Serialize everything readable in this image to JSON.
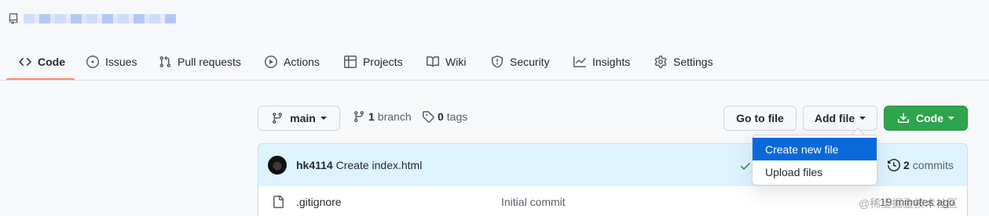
{
  "repo": {
    "name_blurred": ""
  },
  "nav": {
    "tabs": [
      {
        "label": "Code",
        "icon": "code-icon",
        "selected": true
      },
      {
        "label": "Issues",
        "icon": "issue-icon"
      },
      {
        "label": "Pull requests",
        "icon": "pull-request-icon"
      },
      {
        "label": "Actions",
        "icon": "play-icon"
      },
      {
        "label": "Projects",
        "icon": "table-icon"
      },
      {
        "label": "Wiki",
        "icon": "book-icon"
      },
      {
        "label": "Security",
        "icon": "shield-icon"
      },
      {
        "label": "Insights",
        "icon": "graph-icon"
      },
      {
        "label": "Settings",
        "icon": "gear-icon"
      }
    ]
  },
  "toolbar": {
    "branch_label": "main",
    "branch_count": "1",
    "branch_word": "branch",
    "tag_count": "0",
    "tag_word": "tags",
    "go_to_file": "Go to file",
    "add_file": "Add file",
    "code": "Code"
  },
  "add_file_menu": {
    "items": [
      {
        "label": "Create new file",
        "active": true
      },
      {
        "label": "Upload files",
        "active": false
      }
    ]
  },
  "latest_commit": {
    "author": "hk4114",
    "message": "Create index.html",
    "status": "success",
    "commit_count": "2",
    "commit_word": "commits"
  },
  "files": [
    {
      "name": ".gitignore",
      "message": "Initial commit",
      "age": "19 minutes ago",
      "type": "file"
    }
  ],
  "watermark": "@稀土掘金技术社区",
  "colors": {
    "accent_green": "#2da44e",
    "selected_tab_underline": "#fd8c73",
    "menu_active": "#0969da",
    "commit_bg": "#ddf4ff"
  }
}
